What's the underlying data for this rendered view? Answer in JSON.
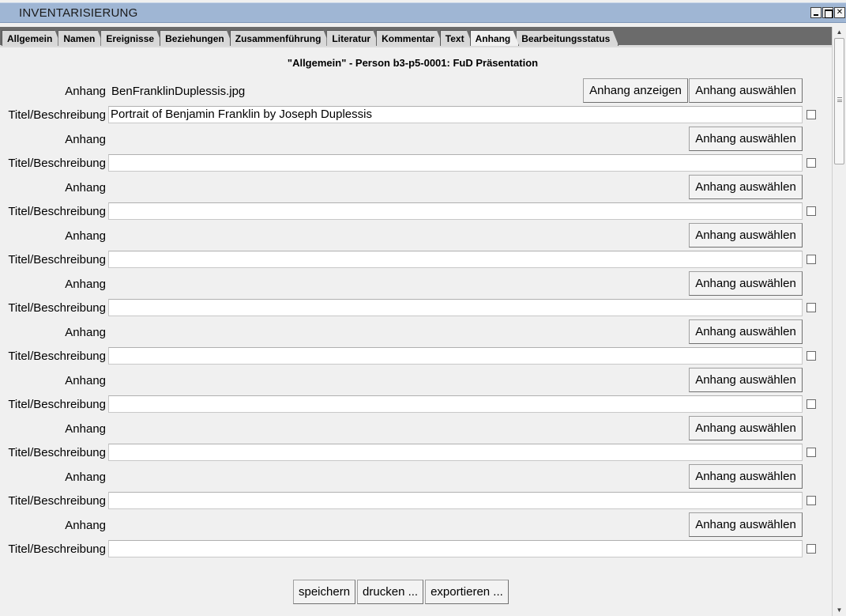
{
  "window": {
    "title": "INVENTARISIERUNG"
  },
  "tabs": [
    {
      "label": "Allgemein"
    },
    {
      "label": "Namen"
    },
    {
      "label": "Ereignisse"
    },
    {
      "label": "Beziehungen"
    },
    {
      "label": "Zusammenführung"
    },
    {
      "label": "Literatur"
    },
    {
      "label": "Kommentar"
    },
    {
      "label": "Text"
    },
    {
      "label": "Anhang",
      "active": true
    },
    {
      "label": "Bearbeitungsstatus"
    }
  ],
  "heading": "\"Allgemein\" - Person b3-p5-0001: FuD Präsentation",
  "labels": {
    "anhang": "Anhang",
    "titel": "Titel/Beschreibung",
    "show_button": "Anhang anzeigen",
    "select_button": "Anhang auswählen"
  },
  "attachments": [
    {
      "file": "BenFranklinDuplessis.jpg",
      "title": "Portrait of Benjamin Franklin by Joseph Duplessis"
    },
    {
      "file": "",
      "title": ""
    },
    {
      "file": "",
      "title": ""
    },
    {
      "file": "",
      "title": ""
    },
    {
      "file": "",
      "title": ""
    },
    {
      "file": "",
      "title": ""
    },
    {
      "file": "",
      "title": ""
    },
    {
      "file": "",
      "title": ""
    },
    {
      "file": "",
      "title": ""
    },
    {
      "file": "",
      "title": ""
    }
  ],
  "footer": {
    "save": "speichern",
    "print": "drucken ...",
    "export": "exportieren ..."
  }
}
